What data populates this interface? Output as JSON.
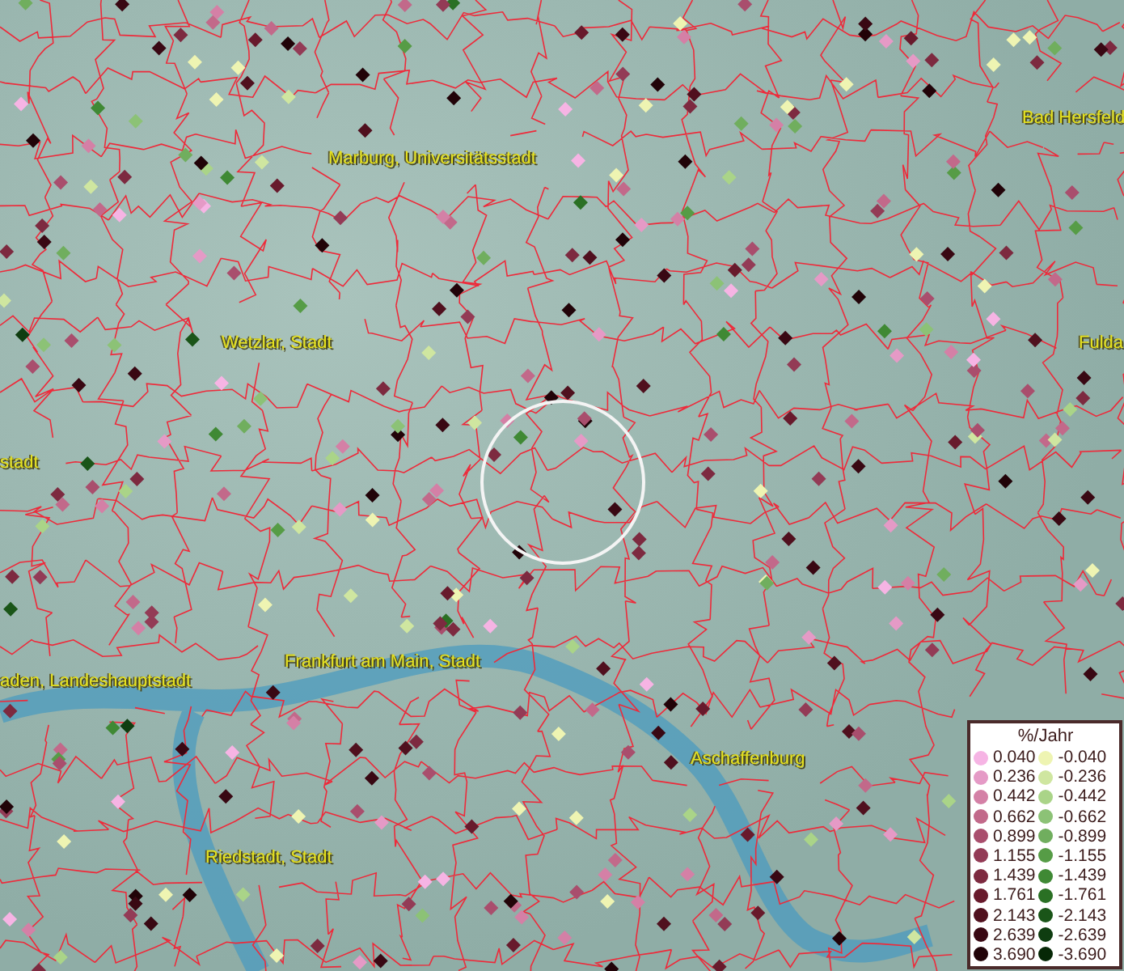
{
  "map": {
    "places": [
      {
        "name": "Bad Hersfeld"
      },
      {
        "name": "Marburg, Universitätsstadt"
      },
      {
        "name": "Wetzlar, Stadt"
      },
      {
        "name": "Fulda"
      },
      {
        "name": "stadt"
      },
      {
        "name": "Frankfurt am Main, Stadt"
      },
      {
        "name": "aden, Landeshauptstadt"
      },
      {
        "name": "Aschaffenburg"
      },
      {
        "name": "Riedstadt, Stadt"
      }
    ]
  },
  "legend": {
    "title": "%/Jahr",
    "rising": [
      {
        "label": "0.040",
        "color": "#f6b4e4"
      },
      {
        "label": "0.236",
        "color": "#e59ac6"
      },
      {
        "label": "0.442",
        "color": "#d480a6"
      },
      {
        "label": "0.662",
        "color": "#c2698a"
      },
      {
        "label": "0.899",
        "color": "#a94e6d"
      },
      {
        "label": "1.155",
        "color": "#933b56"
      },
      {
        "label": "1.439",
        "color": "#7d2a40"
      },
      {
        "label": "1.761",
        "color": "#681a2c"
      },
      {
        "label": "2.143",
        "color": "#50101e"
      },
      {
        "label": "2.639",
        "color": "#390813"
      },
      {
        "label": "3.690",
        "color": "#210308"
      }
    ],
    "falling": [
      {
        "label": "-0.040",
        "color": "#eef4b2"
      },
      {
        "label": "-0.236",
        "color": "#cfe6a0"
      },
      {
        "label": "-0.442",
        "color": "#aad488"
      },
      {
        "label": "-0.662",
        "color": "#8cc276"
      },
      {
        "label": "-0.899",
        "color": "#70ae5e"
      },
      {
        "label": "-1.155",
        "color": "#569c46"
      },
      {
        "label": "-1.439",
        "color": "#3f8934"
      },
      {
        "label": "-1.761",
        "color": "#2a7024"
      },
      {
        "label": "-2.143",
        "color": "#1a5518"
      },
      {
        "label": "-2.639",
        "color": "#0f3d10"
      },
      {
        "label": "-3.690",
        "color": "#062806"
      }
    ]
  }
}
